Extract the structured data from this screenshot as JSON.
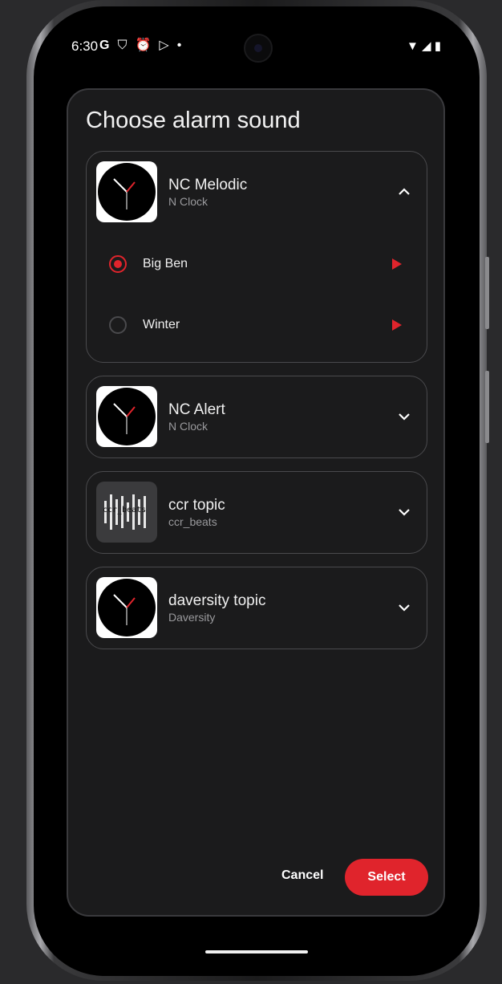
{
  "status_bar": {
    "time": "6:30",
    "icons": [
      "google-icon",
      "shield-icon",
      "alarm-icon",
      "play-store-icon",
      "dot-icon"
    ],
    "right_icons": [
      "wifi-icon",
      "signal-icon",
      "battery-icon"
    ]
  },
  "dialog": {
    "title": "Choose alarm sound",
    "groups": [
      {
        "name": "NC Melodic",
        "source": "N Clock",
        "expanded": true,
        "options": [
          {
            "label": "Big Ben",
            "selected": true
          },
          {
            "label": "Winter",
            "selected": false
          }
        ]
      },
      {
        "name": "NC Alert",
        "source": "N Clock",
        "expanded": false
      },
      {
        "name": "ccr topic",
        "source": "ccr_beats",
        "expanded": false,
        "thumb_text": "ccr_beats"
      },
      {
        "name": "daversity topic",
        "source": "Daversity",
        "expanded": false
      }
    ],
    "cancel_label": "Cancel",
    "select_label": "Select"
  },
  "colors": {
    "accent": "#e0242c",
    "dialog_bg": "#1b1b1c",
    "border": "#4a4a4d"
  }
}
